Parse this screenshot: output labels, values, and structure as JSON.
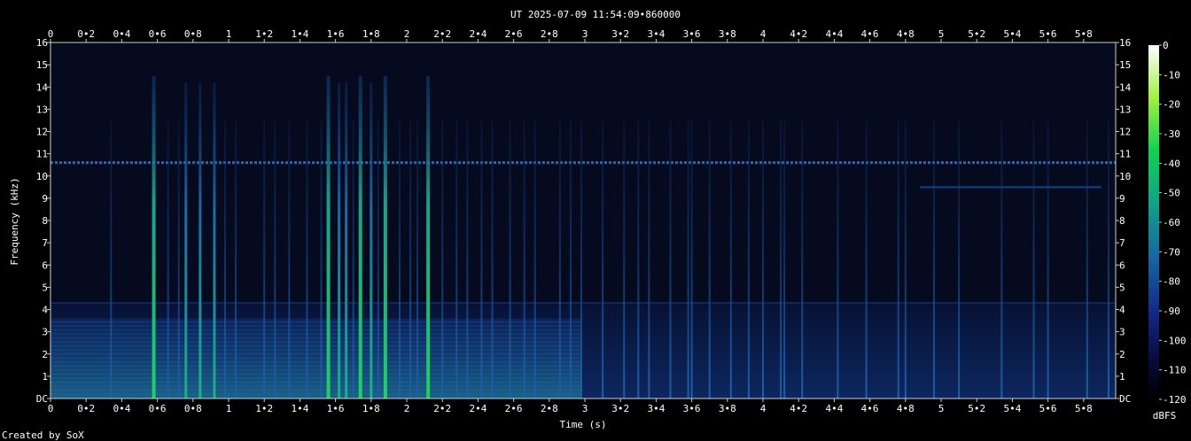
{
  "chart_data": {
    "type": "heatmap",
    "title": "UT 2025-07-09 11:54:09•860000",
    "xlabel": "Time (s)",
    "ylabel": "Frequency (kHz)",
    "footer": "Created by SoX",
    "colorbar_label": "dBFS",
    "xlim": [
      0,
      5.98
    ],
    "ylim": [
      0,
      16
    ],
    "x_ticks": [
      "0",
      "0•2",
      "0•4",
      "0•6",
      "0•8",
      "1",
      "1•2",
      "1•4",
      "1•6",
      "1•8",
      "2",
      "2•2",
      "2•4",
      "2•6",
      "2•8",
      "3",
      "3•2",
      "3•4",
      "3•6",
      "3•8",
      "4",
      "4•2",
      "4•4",
      "4•6",
      "4•8",
      "5",
      "5•2",
      "5•4",
      "5•6",
      "5•8"
    ],
    "y_ticks": [
      "DC",
      "1",
      "2",
      "3",
      "4",
      "5",
      "6",
      "7",
      "8",
      "9",
      "10",
      "11",
      "12",
      "13",
      "14",
      "15",
      "16"
    ],
    "colorbar_ticks": [
      "0",
      "-10",
      "-20",
      "-30",
      "-40",
      "-50",
      "-60",
      "-70",
      "-80",
      "-90",
      "-100",
      "-110",
      "-120"
    ],
    "colorbar_range": [
      -120,
      0
    ],
    "colors": {
      "background": "#000000",
      "plot_background": "#050a1e",
      "low": "#0a1650",
      "mid": "#1a5aa0",
      "high": "#20d060"
    },
    "features": {
      "tone_khz": 10.6,
      "tone2_khz": 9.5,
      "tone2_range_s": [
        4.88,
        5.9
      ],
      "low_band_range_s": [
        0,
        2.98
      ],
      "low_band_top_khz": 3.0,
      "bright_clicks_s": [
        0.58,
        1.56,
        1.74,
        1.88,
        2.12
      ],
      "medium_clicks_s": [
        0.76,
        0.84,
        0.92,
        1.62,
        1.66,
        1.8
      ],
      "faint_clicks_s": [
        0.34,
        0.66,
        0.72,
        0.98,
        1.04,
        1.2,
        1.26,
        1.34,
        1.44,
        1.52,
        1.7,
        1.84,
        1.96,
        2.02,
        2.06,
        2.2,
        2.28,
        2.34,
        2.42,
        2.48,
        2.58,
        2.66,
        2.72,
        2.86,
        2.92,
        2.98,
        3.1,
        3.22,
        3.3,
        3.36,
        3.48,
        3.58,
        3.6,
        3.7,
        3.82,
        3.92,
        4.0,
        4.1,
        4.12,
        4.22,
        4.42,
        4.58,
        4.76,
        4.8,
        4.96,
        5.1,
        5.34,
        5.52,
        5.6,
        5.82,
        5.94
      ]
    }
  }
}
